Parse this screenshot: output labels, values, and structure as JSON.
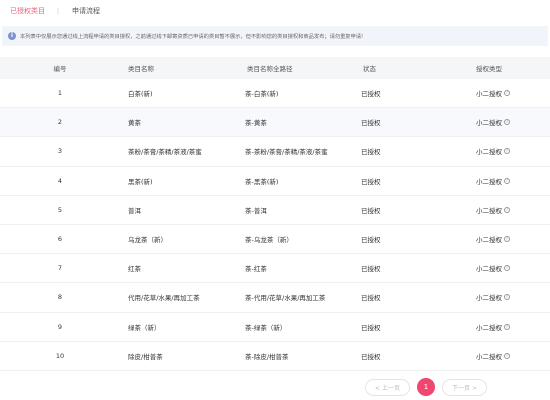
{
  "tabs": [
    {
      "label": "已授权类目",
      "active": true
    },
    {
      "label": "申请流程",
      "active": false
    }
  ],
  "tab_separator": "|",
  "notice": {
    "icon": "info-icon",
    "text": "本列表中仅展示您通过线上流程申请的类目授权，之前通过线下邮寄资质已申请的类目暂不展示，但不影响您的类目授权和商品发布；请勿重复申请!"
  },
  "table": {
    "headers": [
      "编号",
      "类目名称",
      "类目名称全路径",
      "状态",
      "授权类型"
    ],
    "rows": [
      {
        "no": "1",
        "name": "白茶(新)",
        "path": "茶-白茶(新)",
        "status": "已授权",
        "type": "小二授权"
      },
      {
        "no": "2",
        "name": "黄茶",
        "path": "茶-黄茶",
        "status": "已授权",
        "type": "小二授权"
      },
      {
        "no": "3",
        "name": "茶粉/茶膏/茶精/茶液/茶蜜",
        "path": "茶-茶粉/茶膏/茶精/茶液/茶蜜",
        "status": "已授权",
        "type": "小二授权"
      },
      {
        "no": "4",
        "name": "黑茶(新)",
        "path": "茶-黑茶(新)",
        "status": "已授权",
        "type": "小二授权"
      },
      {
        "no": "5",
        "name": "普洱",
        "path": "茶-普洱",
        "status": "已授权",
        "type": "小二授权"
      },
      {
        "no": "6",
        "name": "乌龙茶（新）",
        "path": "茶-乌龙茶（新）",
        "status": "已授权",
        "type": "小二授权"
      },
      {
        "no": "7",
        "name": "红茶",
        "path": "茶-红茶",
        "status": "已授权",
        "type": "小二授权"
      },
      {
        "no": "8",
        "name": "代用/花草/水果/再加工茶",
        "path": "茶-代用/花草/水果/再加工茶",
        "status": "已授权",
        "type": "小二授权"
      },
      {
        "no": "9",
        "name": "绿茶（新）",
        "path": "茶-绿茶（新）",
        "status": "已授权",
        "type": "小二授权"
      },
      {
        "no": "10",
        "name": "除皮/柑普茶",
        "path": "茶-除皮/柑普茶",
        "status": "已授权",
        "type": "小二授权"
      }
    ],
    "highlighted_row": 2,
    "type_help_icon": "question-circle-icon"
  },
  "pagination": {
    "prev_label": "< 上一页",
    "current_page": "1",
    "next_label": "下一页 >"
  },
  "colors": {
    "accent": "#f65e7a",
    "pager_active": "#f0466f",
    "notice_bg": "#f1f4fb",
    "header_bg": "#f5f6f8",
    "highlight_row": "#f7f9fd"
  }
}
